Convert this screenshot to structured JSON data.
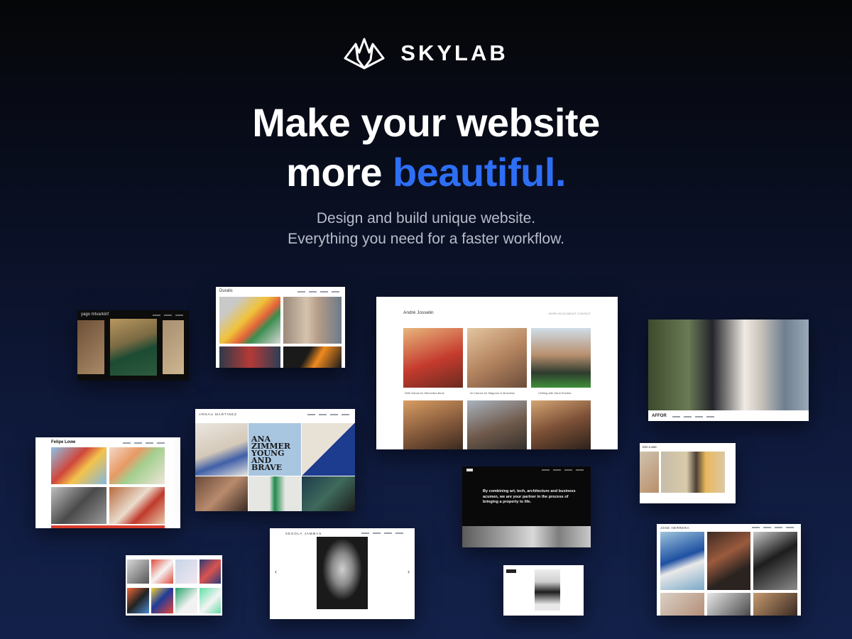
{
  "brand": {
    "name": "SKYLAB",
    "logo_icon": "mountain-logo-icon"
  },
  "headline": {
    "line1": "Make your website",
    "line2_prefix": "more ",
    "line2_accent": "beautiful."
  },
  "subheadline": {
    "line1": "Design and build unique website.",
    "line2": "Everything you need for a faster workflow."
  },
  "colors": {
    "accent": "#2d6ef5",
    "bg_top": "#050608",
    "bg_bottom": "#13214a"
  },
  "previews": {
    "c1": {
      "title": "yago mtvarkinf"
    },
    "c2": {
      "title": "Duralis"
    },
    "c3": {
      "title": "André Josselin",
      "nav": "WORK   BLOG   ABOUT   CONTACT",
      "cap1": "With Hanna for Mercedes-Benz",
      "cap2": "At Cannes for Magnum & Moschino",
      "cap3": "Chilling with Sami Khedira"
    },
    "c4": {
      "nav": "AFFOR"
    },
    "c5": {
      "title": "Felipe Lowe"
    },
    "c6": {
      "title": "ARNAU MARTINEZ",
      "poster": "ANA ZIMMER YOUNG AND BRAVE"
    },
    "c7": {
      "title": "Kim Lowe"
    },
    "c8": {
      "tagline": "By combining art, tech, architecture and business acumen, we are your partner in the process of bringing a property to life."
    },
    "c9": {
      "title": "SEGOLA JAMMAS"
    },
    "c10": {
      "title": "JOSE HERRERA"
    }
  }
}
